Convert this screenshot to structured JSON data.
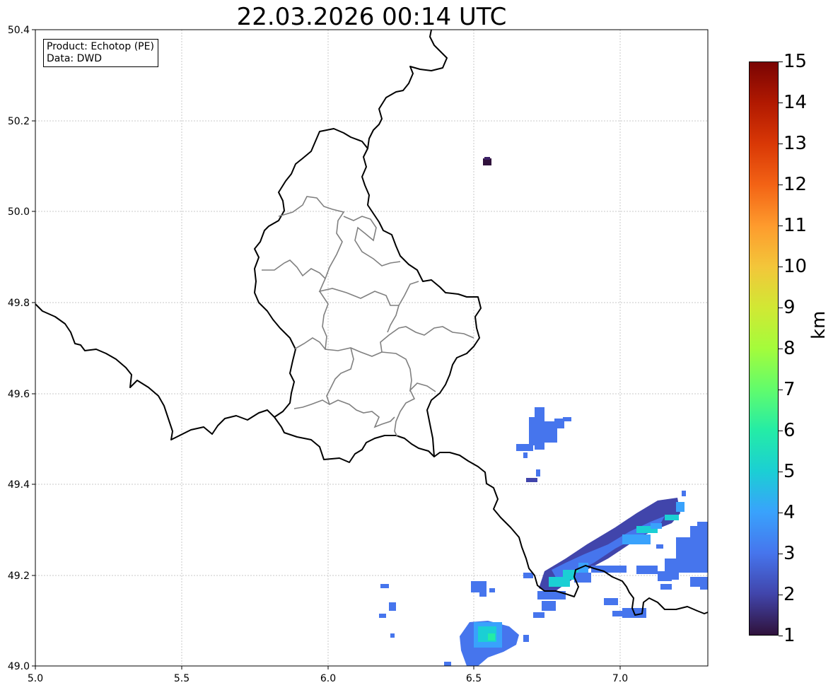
{
  "title": "22.03.2026 00:14 UTC",
  "info": {
    "product": "Product: Echotop (PE)",
    "data": "Data: DWD"
  },
  "map": {
    "lon_range": [
      5.0,
      7.3
    ],
    "lat_range": [
      49.0,
      50.4
    ],
    "x_ticks": [
      "5.0",
      "5.5",
      "6.0",
      "6.5",
      "7.0"
    ],
    "y_ticks": [
      "49.0",
      "49.2",
      "49.4",
      "49.6",
      "49.8",
      "50.0",
      "50.2",
      "50.4"
    ],
    "grid": true,
    "border_color": "#000000",
    "canton_color": "#808080"
  },
  "colorbar": {
    "label": "km",
    "min": 1,
    "max": 15,
    "ticks": [
      "1",
      "2",
      "3",
      "4",
      "5",
      "6",
      "7",
      "8",
      "9",
      "10",
      "11",
      "12",
      "13",
      "14",
      "15"
    ],
    "colormap": "turbo",
    "colors": [
      "#30123b",
      "#4145ab",
      "#4675ed",
      "#39a2fc",
      "#1bcfd4",
      "#24eca6",
      "#61fc6c",
      "#a4fc3b",
      "#d1e834",
      "#f3c63a",
      "#fe9b2d",
      "#f36315",
      "#d93806",
      "#b11901",
      "#7a0403"
    ]
  },
  "echo_cells": [
    {
      "lon": 6.55,
      "lat": 50.11,
      "km": 1.5
    },
    {
      "lon": 6.76,
      "lat": 49.52,
      "km": 3.0
    },
    {
      "lon": 6.73,
      "lat": 49.41,
      "km": 2.2
    },
    {
      "lon": 6.9,
      "lat": 49.26,
      "km": 3.0
    },
    {
      "lon": 7.25,
      "lat": 49.24,
      "km": 3.2
    },
    {
      "lon": 6.53,
      "lat": 49.06,
      "km": 3.3
    },
    {
      "lon": 6.53,
      "lat": 49.07,
      "km": 5.0
    },
    {
      "lon": 6.55,
      "lat": 49.17,
      "km": 3.2
    },
    {
      "lon": 6.21,
      "lat": 49.13,
      "km": 3.2
    },
    {
      "lon": 6.81,
      "lat": 49.19,
      "km": 4.5
    }
  ]
}
